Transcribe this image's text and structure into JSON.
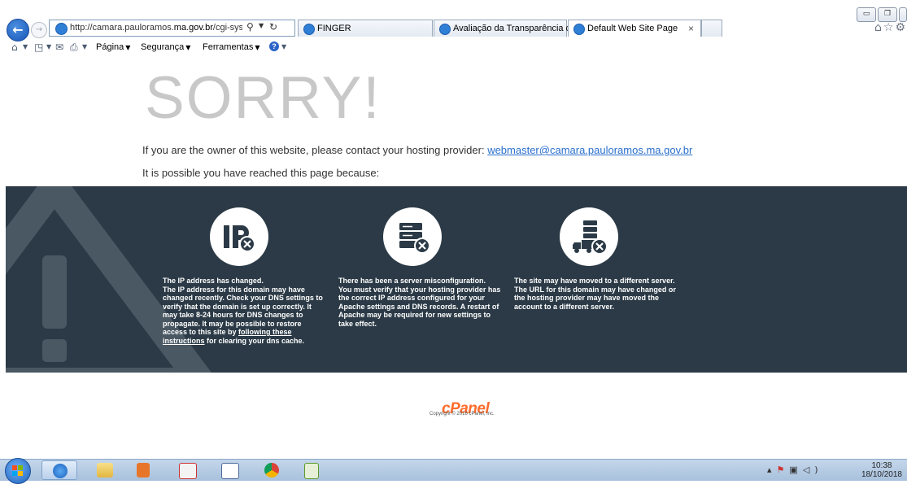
{
  "browser": {
    "address_url_prefix": "http://camara.pauloramos.",
    "address_url_domain": "ma.gov.br",
    "address_url_suffix": "/cgi-sys/default",
    "tabs": [
      {
        "label": "FINGER"
      },
      {
        "label": "Avaliação da Transparência do..."
      },
      {
        "label": "Default Web Site Page"
      }
    ],
    "tab_close_glyph": "×",
    "command_bar": {
      "page_label": "Página",
      "security_label": "Segurança",
      "tools_label": "Ferramentas"
    },
    "icons": {
      "back": "back-arrow-icon",
      "forward": "forward-arrow-icon",
      "search": "search-icon",
      "refresh": "refresh-icon",
      "home": "home-icon",
      "favorites": "star-icon",
      "tools": "gear-icon"
    }
  },
  "page": {
    "heading": "SORRY!",
    "owner_text": "If you are the owner of this website, please contact your hosting provider: ",
    "owner_email": "webmaster@camara.pauloramos.ma.gov.br",
    "reason_intro": "It is possible you have reached this page because:",
    "reasons": [
      {
        "icon": "ip-address-icon",
        "title": "The IP address has changed.",
        "body": "The IP address for this domain may have changed recently. Check your DNS settings to verify that the domain is set up correctly. It may take 8-24 hours for DNS changes to propagate. It may be possible to restore access to this site by ",
        "link": "following these instructions",
        "body_after": " for clearing your dns cache."
      },
      {
        "icon": "server-error-icon",
        "title": "There has been a server misconfiguration.",
        "body": "You must verify that your hosting provider has the correct IP address configured for your Apache settings and DNS records. A restart of Apache may be required for new settings to take effect."
      },
      {
        "icon": "moving-truck-icon",
        "title": "The site may have moved to a different server.",
        "body": "The URL for this domain may have changed or the hosting provider may have moved the account to a different server."
      }
    ],
    "footer_logo": "cPanel",
    "footer_copyright": "Copyright © 2016 cPanel, Inc."
  },
  "taskbar": {
    "clock_time": "10:38",
    "clock_date": "18/10/2018"
  },
  "colors": {
    "panel_bg": "#2b3a46",
    "heading": "#c8c8c8",
    "link": "#2a6fcc",
    "cpanel_orange": "#ff6c2c"
  }
}
